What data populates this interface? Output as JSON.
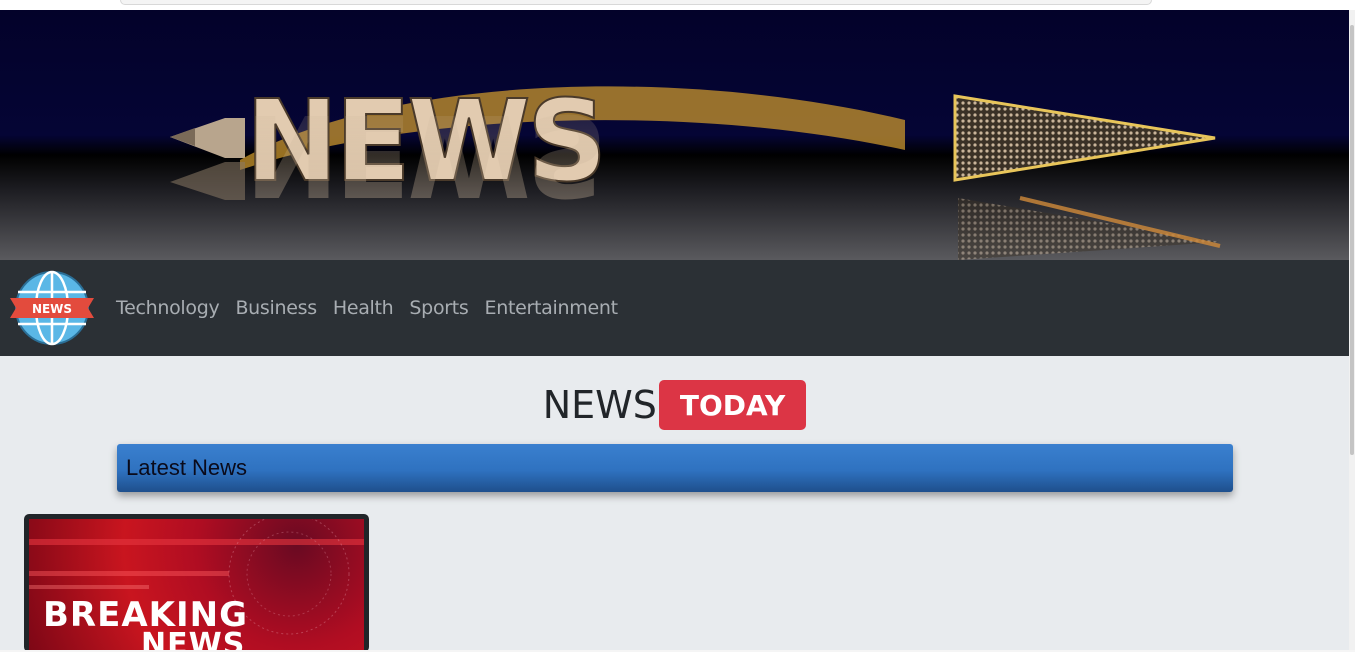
{
  "banner": {
    "word": "NEWS"
  },
  "logo": {
    "label": "NEWS"
  },
  "nav": {
    "items": [
      "Technology",
      "Business",
      "Health",
      "Sports",
      "Entertainment"
    ]
  },
  "headline": {
    "word": "NEWS",
    "badge": "TODAY"
  },
  "latest": {
    "title": "Latest News"
  },
  "card": {
    "line1": "BREAKING",
    "line2": "NEWS"
  },
  "colors": {
    "navbar": "#2b3035",
    "badge": "#dc3545",
    "latest_bar": "#2f72c0",
    "page_bg": "#e8ebee"
  }
}
